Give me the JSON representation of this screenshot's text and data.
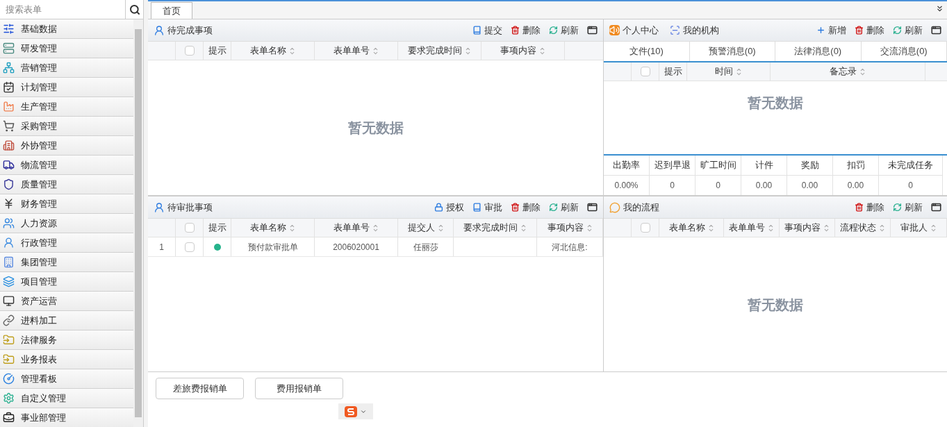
{
  "search": {
    "placeholder": "搜索表单"
  },
  "sidebar": {
    "items": [
      {
        "label": "基础数据"
      },
      {
        "label": "研发管理"
      },
      {
        "label": "营销管理"
      },
      {
        "label": "计划管理"
      },
      {
        "label": "生产管理"
      },
      {
        "label": "采购管理"
      },
      {
        "label": "外协管理"
      },
      {
        "label": "物流管理"
      },
      {
        "label": "质量管理"
      },
      {
        "label": "财务管理"
      },
      {
        "label": "人力资源"
      },
      {
        "label": "行政管理"
      },
      {
        "label": "集团管理"
      },
      {
        "label": "项目管理"
      },
      {
        "label": "资产运营"
      },
      {
        "label": "进料加工"
      },
      {
        "label": "法律服务"
      },
      {
        "label": "业务报表"
      },
      {
        "label": "管理看板"
      },
      {
        "label": "自定义管理"
      },
      {
        "label": "事业部管理"
      }
    ]
  },
  "tabs": [
    {
      "label": "首页",
      "selected": true
    }
  ],
  "pending": {
    "title": "待完成事项",
    "actions": [
      {
        "kind": "submit",
        "label": "提交"
      },
      {
        "kind": "delete",
        "label": "删除"
      },
      {
        "kind": "refresh",
        "label": "刷新"
      }
    ],
    "columns": [
      {
        "label": "提示",
        "sortable": false
      },
      {
        "label": "表单名称",
        "sortable": true
      },
      {
        "label": "表单单号",
        "sortable": true
      },
      {
        "label": "要求完成时间",
        "sortable": true
      },
      {
        "label": "事项内容",
        "sortable": true
      }
    ],
    "header_checked": false,
    "empty_text": "暂无数据"
  },
  "approval": {
    "title": "待审批事项",
    "actions": [
      {
        "kind": "lock",
        "label": "授权"
      },
      {
        "kind": "submit",
        "label": "审批"
      },
      {
        "kind": "delete",
        "label": "删除"
      },
      {
        "kind": "refresh",
        "label": "刷新"
      }
    ],
    "columns": [
      {
        "label": "提示",
        "sortable": false
      },
      {
        "label": "表单名称",
        "sortable": true
      },
      {
        "label": "表单单号",
        "sortable": true
      },
      {
        "label": "提交人",
        "sortable": true
      },
      {
        "label": "要求完成时间",
        "sortable": true
      },
      {
        "label": "事项内容",
        "sortable": true
      }
    ],
    "header_checked": false,
    "rows": [
      {
        "number": "1",
        "checked": false,
        "color": "#26b38c",
        "cells": [
          "",
          "预付款审批单",
          "2006020001",
          "任丽莎",
          "",
          "河北信息:"
        ]
      }
    ]
  },
  "personal": {
    "titles": [
      {
        "kind": "speaker",
        "label": "个人中心"
      },
      {
        "kind": "org",
        "label": "我的机构"
      }
    ],
    "actions": [
      {
        "kind": "add",
        "label": "新增"
      },
      {
        "kind": "delete",
        "label": "删除"
      },
      {
        "kind": "refresh",
        "label": "刷新"
      }
    ],
    "subtabs": [
      "文件(10)",
      "预警消息(0)",
      "法律消息(0)",
      "交流消息(0)"
    ],
    "columns": [
      {
        "label": "提示",
        "sortable": false
      },
      {
        "label": "时间",
        "sortable": true
      },
      {
        "label": "备忘录",
        "sortable": true
      }
    ],
    "header_checked": false,
    "empty_text": "暂无数据",
    "attendance": {
      "headers": [
        "出勤率",
        "迟到早退",
        "旷工时间",
        "计件",
        "奖励",
        "扣罚",
        "未完成任务"
      ],
      "values": [
        "0.00%",
        "0",
        "0",
        "0.00",
        "0.00",
        "0.00",
        "0"
      ]
    }
  },
  "flow": {
    "title": "我的流程",
    "actions": [
      {
        "kind": "delete",
        "label": "删除"
      },
      {
        "kind": "refresh",
        "label": "刷新"
      }
    ],
    "columns": [
      {
        "label": "表单名称",
        "sortable": true
      },
      {
        "label": "表单单号",
        "sortable": true
      },
      {
        "label": "事项内容",
        "sortable": true
      },
      {
        "label": "流程状态",
        "sortable": true
      },
      {
        "label": "审批人",
        "sortable": true
      }
    ],
    "header_checked": false,
    "empty_text": "暂无数据"
  },
  "buttons": [
    "差旅费报销单",
    "费用报销单"
  ]
}
